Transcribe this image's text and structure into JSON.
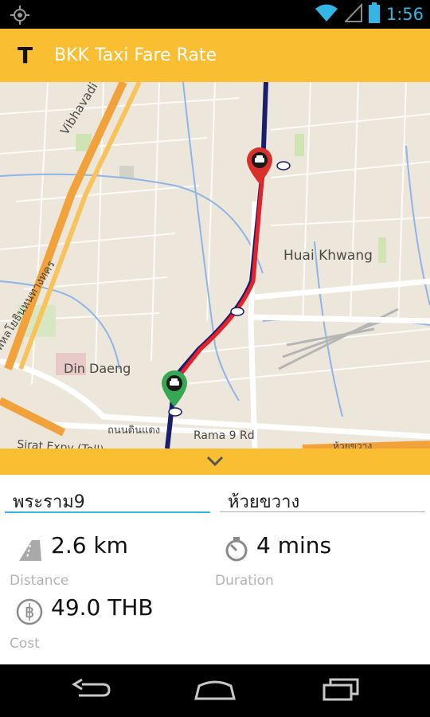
{
  "status_bar": {
    "time": "1:56"
  },
  "app_bar": {
    "logo": "T",
    "title": "BKK Taxi Fare Rate"
  },
  "map": {
    "labels": {
      "vibhavadi": "Vibhavadi Rangsit",
      "thai_road": "พหลโยธินหนทางทคร",
      "din_daeng": "Din Daeng",
      "huai_khwang": "Huai Khwang",
      "rama9_thai": "ถนนดินแดง",
      "rama9_en": "Rama 9 Rd",
      "sirat": "Sirat Expy (Toll)",
      "bottom_right": "ห้วยขวาง"
    }
  },
  "route": {
    "origin": "พระราม9",
    "destination": "ห้วยขวาง"
  },
  "stats": {
    "distance_value": "2.6 km",
    "distance_label": "Distance",
    "duration_value": "4 mins",
    "duration_label": "Duration",
    "cost_value": "49.0 THB",
    "cost_label": "Cost"
  },
  "colors": {
    "accent": "#f9be32",
    "route_red": "#e8202a",
    "route_navy": "#1a1f6b",
    "pin_red": "#d9302c",
    "pin_green": "#35a853",
    "field_active_line": "#33b5e5"
  }
}
